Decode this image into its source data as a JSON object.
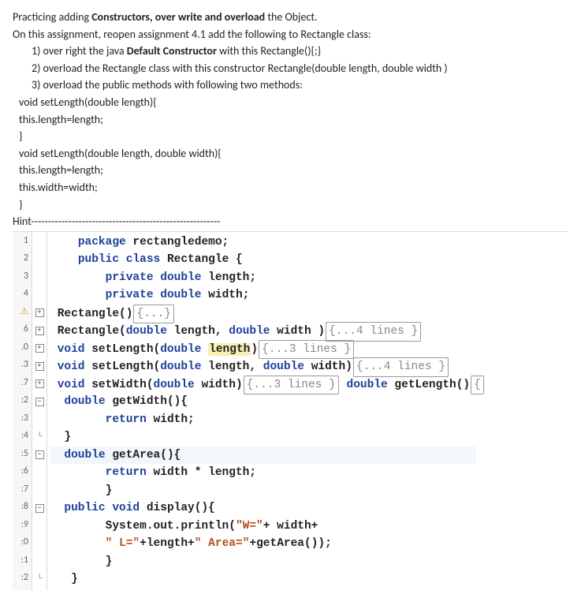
{
  "instructions": {
    "title_pre": "Practicing adding ",
    "title_b": "Constructors, over write and overload",
    "title_post": " the Object.",
    "line2": "On this assignment, reopen assignment 4.1 add the following to Rectangle class:",
    "it1_pre": "1)   over right the java ",
    "it1_b": "Default Constructor",
    "it1_post": " with this Rectangle(){;}",
    "it2": "2)   overload the  Rectangle class with this constructor Rectangle(double length, double width )",
    "it3": "3)   overload the public methods with following two methods:",
    "c1": "void setLength(double length){",
    "c2": "   this.length=length;",
    "c3": "}",
    "c4": "void setLength(double length, double width){",
    "c5": "   this.length=length;",
    "c6": "   this.width=width;",
    "c7": "}",
    "hint": "Hint--------------------------------------------------------"
  },
  "gutter": [
    "1",
    "2",
    "3",
    "4",
    "",
    "6",
    ".0",
    ".3",
    ".7",
    ":2",
    ":3",
    ":4",
    ":5",
    ":6",
    ":7",
    ":8",
    ":9",
    ":0",
    ":1",
    ":2"
  ],
  "fold": [
    "",
    "",
    "",
    "",
    "plus",
    "plus",
    "plus",
    "plus",
    "plus",
    "minus",
    "",
    "L",
    "minus",
    "",
    "",
    "minus",
    "",
    "",
    "",
    "L"
  ],
  "code": {
    "l1_1": "    ",
    "l1_kw1": "package",
    "l1_2": " rectangledemo;",
    "l2_1": "    ",
    "l2_kw1": "public",
    "l2_2": " ",
    "l2_kw2": "class",
    "l2_3": " ",
    "l2_b": "Rectangle",
    "l2_4": " {",
    "l3_1": "        ",
    "l3_kw1": "private",
    "l3_2": " ",
    "l3_kw2": "double",
    "l3_3": " length;",
    "l4_1": "        ",
    "l4_kw1": "private",
    "l4_2": " ",
    "l4_kw2": "double",
    "l4_3": " width;",
    "l5_1": " Rectangle()",
    "l5_f": "{...}",
    "l6_1": " Rectangle(",
    "l6_kw1": "double",
    "l6_2": " length, ",
    "l6_kw2": "double",
    "l6_3": " width )",
    "l6_f": "{...4 lines }",
    "l7_1": " ",
    "l7_kw1": "void",
    "l7_2": " setLength(",
    "l7_kw2": "double",
    "l7_3": " ",
    "l7_hl": "length",
    "l7_4": ")",
    "l7_f": "{...3 lines }",
    "l8_1": " ",
    "l8_kw1": "void",
    "l8_2": " setLength(",
    "l8_kw2": "double",
    "l8_3": " length, ",
    "l8_kw3": "double",
    "l8_4": " width)",
    "l8_f": "{...4 lines }",
    "l9_1": " ",
    "l9_kw1": "void",
    "l9_2": " setWidth(",
    "l9_kw2": "double",
    "l9_3": " width)",
    "l9_f": "{...3 lines }",
    "l9_4": " ",
    "l9_kw3": "double",
    "l9_5": " getLength()",
    "l9_f2": "{",
    "l10_1": "  ",
    "l10_kw1": "double",
    "l10_2": " getWidth(){",
    "l11_1": "        ",
    "l11_kw1": "return",
    "l11_2": " width;",
    "l12_1": "  }",
    "l13_1": "  ",
    "l13_kw1": "double",
    "l13_2": " getArea(){",
    "l14_1": "        ",
    "l14_kw1": "return",
    "l14_2": " width * length;",
    "l15_1": "        }",
    "l16_1": "  ",
    "l16_kw1": "public",
    "l16_2": " ",
    "l16_kw2": "void",
    "l16_3": " display(){",
    "l17_1": "        System.out.println(",
    "l17_s1": "\"W=\"",
    "l17_2": "+ width+",
    "l18_1": "        ",
    "l18_s1": "\" L=\"",
    "l18_2": "+length+",
    "l18_s2": "\" Area=\"",
    "l18_3": "+getArea());",
    "l19_1": "        }",
    "l20_1": "   }"
  }
}
